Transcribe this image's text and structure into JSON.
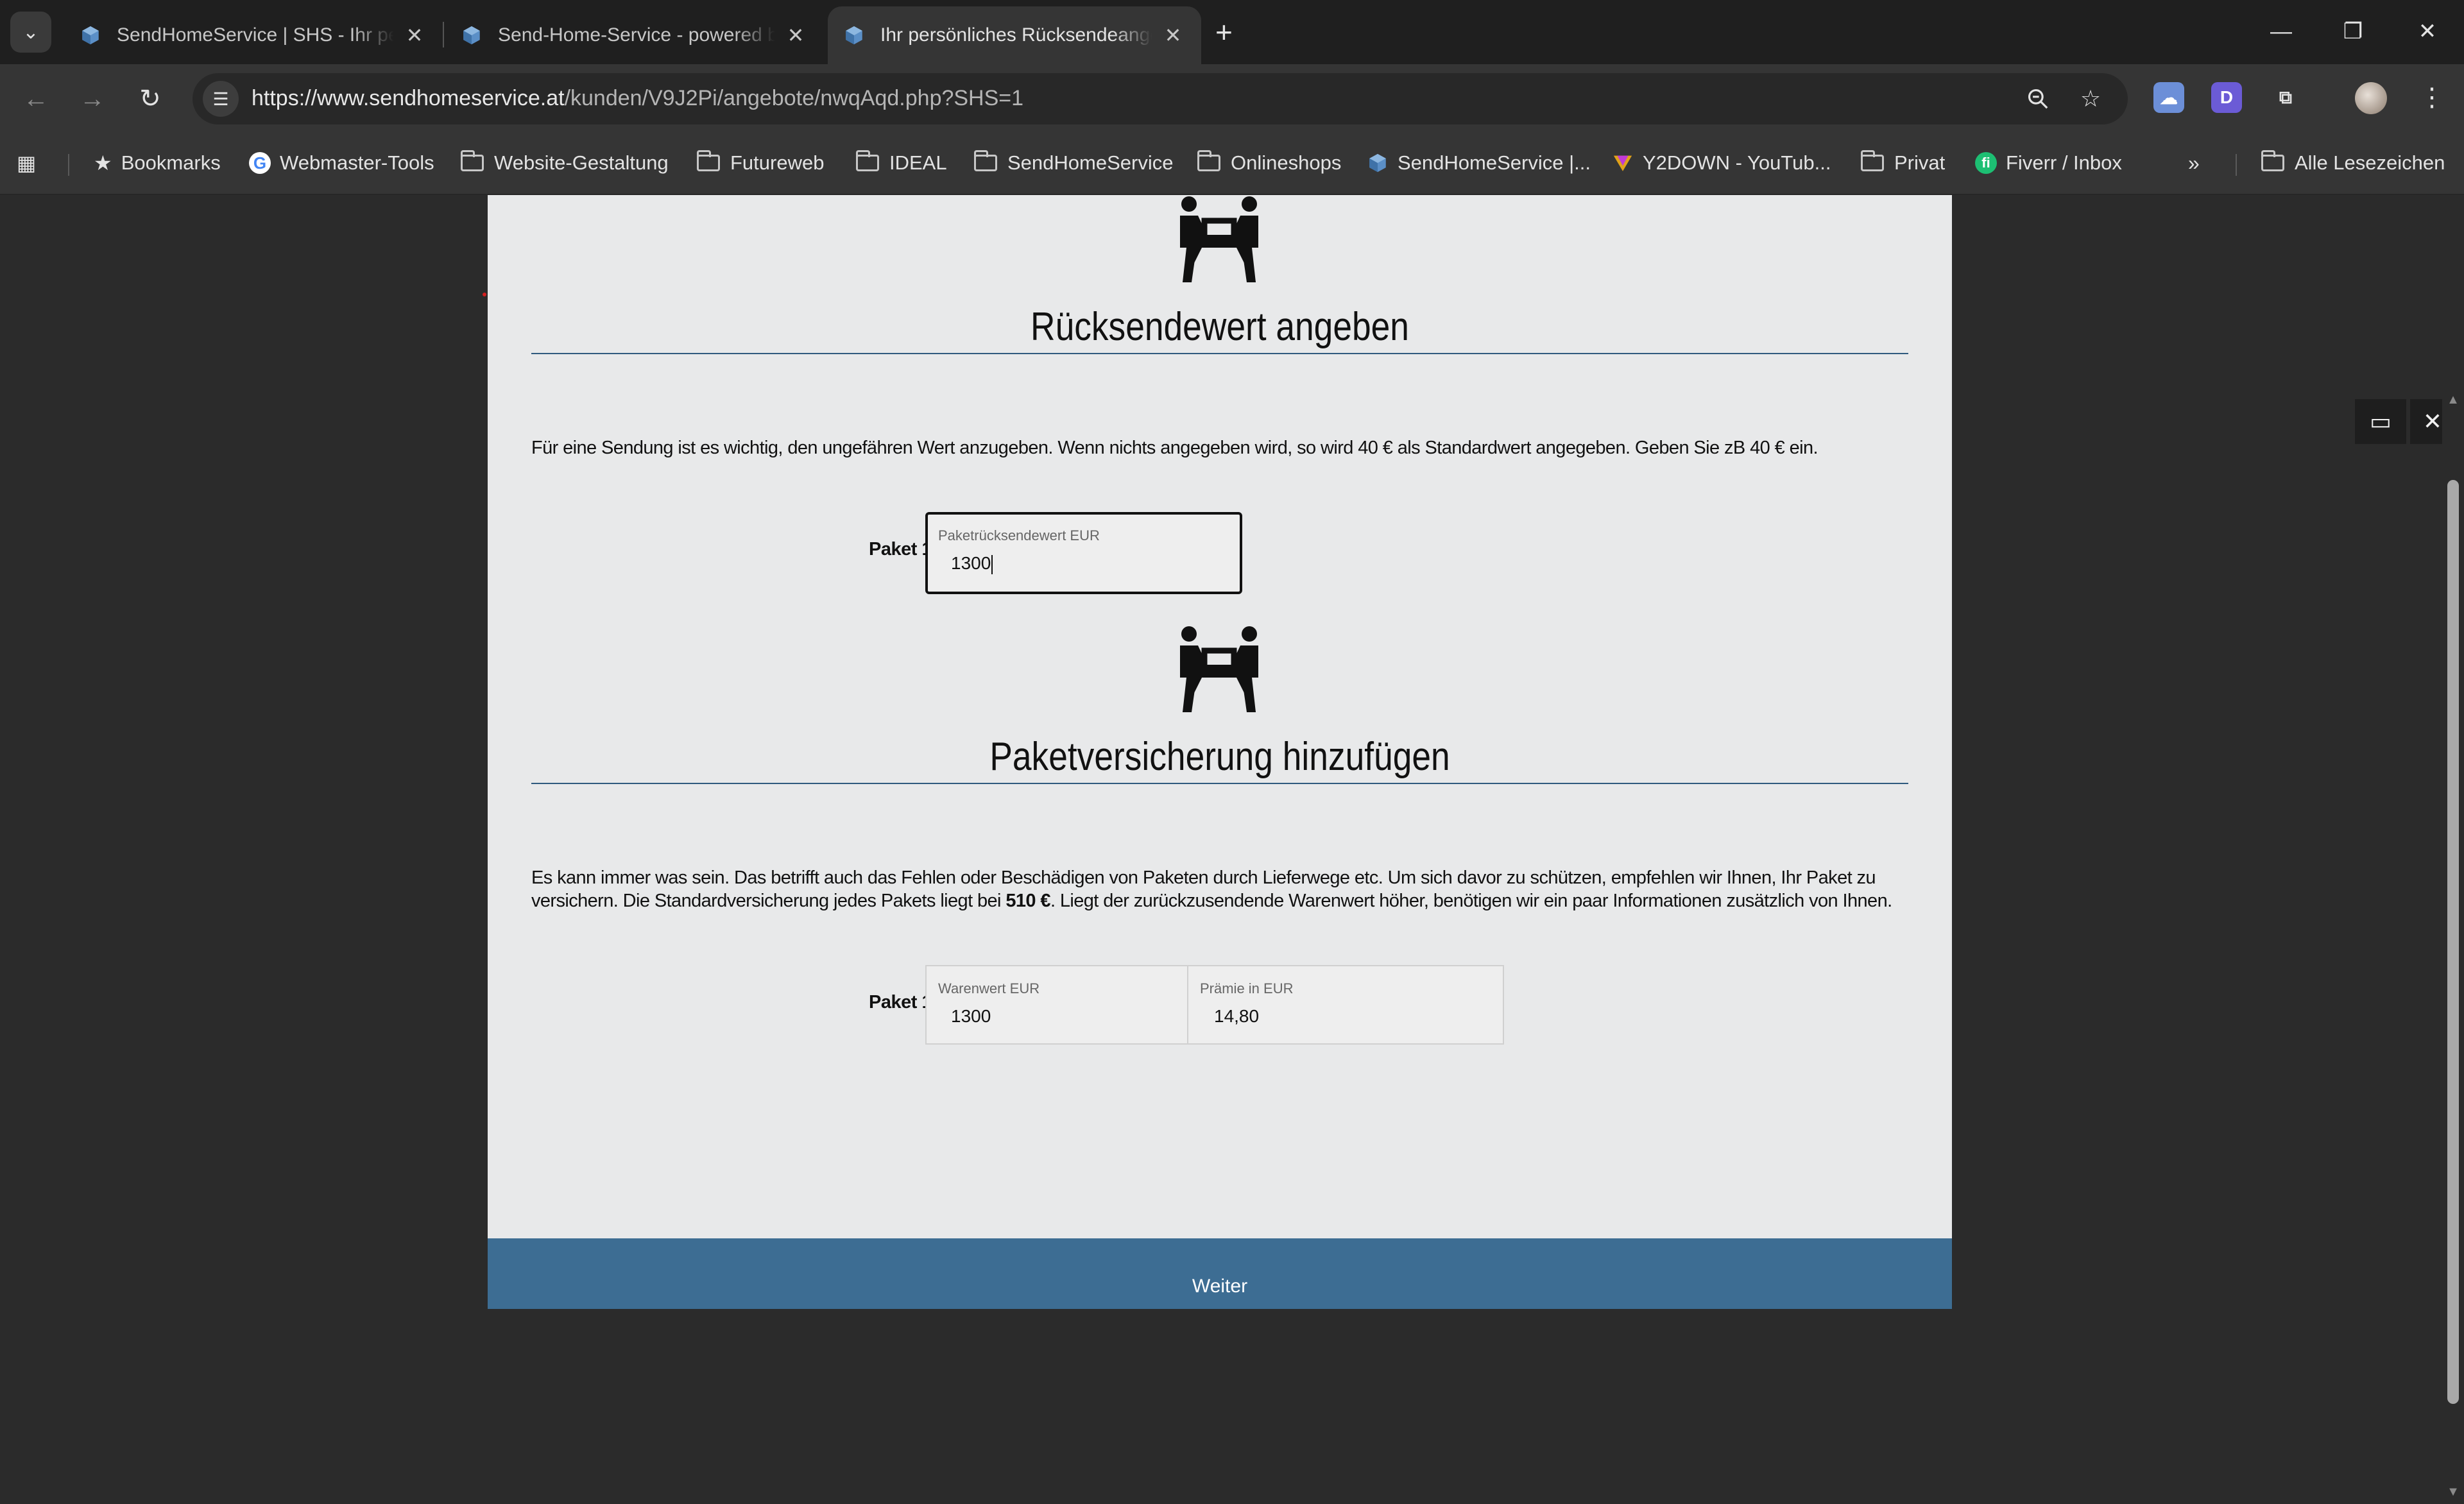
{
  "browser": {
    "tabs": [
      {
        "title": "SendHomeService | SHS - Ihr pers",
        "active": false
      },
      {
        "title": "Send-Home-Service - powered by",
        "active": false
      },
      {
        "title": "Ihr persönliches Rücksendeangebot",
        "active": true
      }
    ],
    "url_host": "https://www.sendhomeservice.at",
    "url_path": "/kunden/V9J2Pi/angebote/nwqAqd.php?SHS=1",
    "bookmarks": [
      {
        "label": "Bookmarks",
        "icon": "star-icon"
      },
      {
        "label": "Webmaster-Tools",
        "icon": "google-icon"
      },
      {
        "label": "Website-Gestaltung",
        "icon": "folder-icon"
      },
      {
        "label": "Futureweb",
        "icon": "folder-icon"
      },
      {
        "label": "IDEAL",
        "icon": "folder-icon"
      },
      {
        "label": "SendHomeService",
        "icon": "folder-icon"
      },
      {
        "label": "Onlineshops",
        "icon": "folder-icon"
      },
      {
        "label": "SendHomeService |...",
        "icon": "cube-icon"
      },
      {
        "label": "Y2DOWN - YouTub...",
        "icon": "y2down-icon"
      },
      {
        "label": "Privat",
        "icon": "folder-icon"
      },
      {
        "label": "Fiverr / Inbox",
        "icon": "fiverr-icon"
      }
    ],
    "all_bookmarks": "Alle Lesezeichen",
    "colors": {
      "accent_blue": "#3d6d93",
      "tab_strip": "#1f1f1f",
      "toolbar": "#353535"
    }
  },
  "page": {
    "section1": {
      "title": "Rücksendewert angeben",
      "text": "Für eine Sendung ist es wichtig, den ungefähren Wert anzugeben. Wenn nichts angegeben wird, so wird 40 € als Standardwert angegeben. Geben Sie zB 40 € ein.",
      "paket_label": "Paket 1",
      "field_label": "Paketrücksendewert EUR",
      "field_value": "1300"
    },
    "section2": {
      "title": "Paketversicherung hinzufügen",
      "text_part1": "Es kann immer was sein. Das betrifft auch das Fehlen oder Beschädigen von Paketen durch Lieferwege etc. Um sich davor zu schützen, empfehlen wir Ihnen, Ihr Paket zu versichern. Die Standardversicherung jedes Pakets liegt bei ",
      "text_bold": "510 €",
      "text_part2": ". Liegt der zurückzusendende Warenwert höher, benötigen wir ein paar Informationen zusätzlich von Ihnen.",
      "paket_label": "Paket 1",
      "warenwert_label": "Warenwert EUR",
      "warenwert_value": "1300",
      "praemie_label": "Prämie in EUR",
      "praemie_value": "14,80"
    },
    "submit_label": "Weiter"
  }
}
